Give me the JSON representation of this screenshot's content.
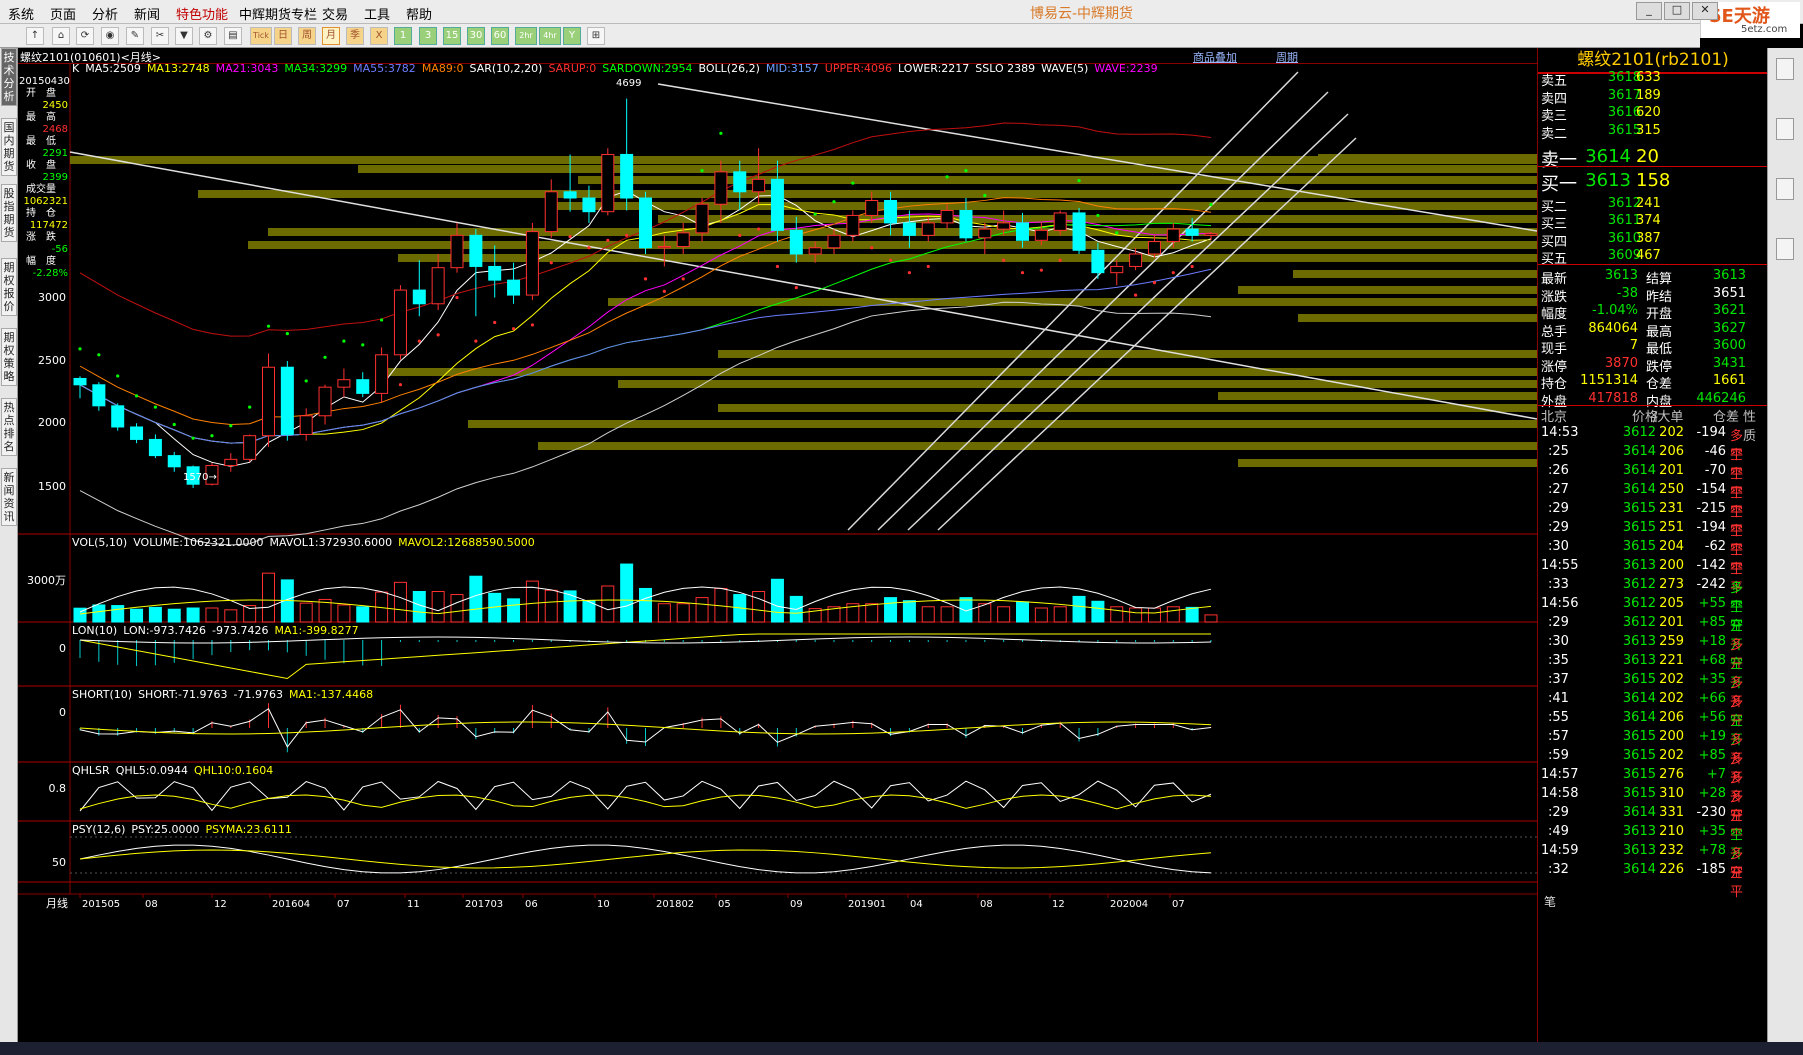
{
  "menu": [
    "系统",
    "页面",
    "分析",
    "新闻",
    "特色功能",
    "中辉期货专栏",
    "交易",
    "工具",
    "帮助"
  ],
  "app_title": "博易云-中辉期货",
  "logo": {
    "text": "5E天游",
    "sub": "5etz.com"
  },
  "window_buttons": [
    "_",
    "□",
    "✕"
  ],
  "toolbar": {
    "buttons": [
      "↑",
      "⌂",
      "⟳",
      "◉",
      "✎",
      "✂",
      "▼",
      "⚙",
      "▤",
      "Tick",
      "日",
      "周",
      "月",
      "季",
      "X",
      "1",
      "3",
      "15",
      "30",
      "60",
      "2hr",
      "4hr",
      "Y",
      "⊞"
    ],
    "selected": "月"
  },
  "left_tabs": [
    "技术分析",
    "国内期货",
    "股指期货",
    "期权报价",
    "期权策略",
    "热点排名",
    "新闻资讯"
  ],
  "chart_header": {
    "title": "螺纹2101(010601)<月线>",
    "links": [
      "商品叠加",
      "周期"
    ]
  },
  "main_indicator_line": [
    {
      "t": "K",
      "c": "#ffffff"
    },
    {
      "t": "MA5:2509",
      "c": "#ffffff"
    },
    {
      "t": "MA13:2748",
      "c": "#ffff00"
    },
    {
      "t": "MA21:3043",
      "c": "#ff00ff"
    },
    {
      "t": "MA34:3299",
      "c": "#00ff00"
    },
    {
      "t": "MA55:3782",
      "c": "#6c7cff"
    },
    {
      "t": "MA89:0",
      "c": "#ff8000"
    },
    {
      "t": "SAR(10,2,20)",
      "c": "#ffffff"
    },
    {
      "t": "SARUP:0",
      "c": "#ff3030"
    },
    {
      "t": "SARDOWN:2954",
      "c": "#00ff00"
    },
    {
      "t": "BOLL(26,2)",
      "c": "#ffffff"
    },
    {
      "t": "MID:3157",
      "c": "#6ca0ff"
    },
    {
      "t": "UPPER:4096",
      "c": "#ff3030"
    },
    {
      "t": "LOWER:2217",
      "c": "#ffffff"
    },
    {
      "t": "SSLO 2389",
      "c": "#ffffff"
    },
    {
      "t": "WAVE(5)",
      "c": "#ffffff"
    },
    {
      "t": "WAVE:2239",
      "c": "#ff00ff"
    }
  ],
  "info_box": {
    "date": "20150430",
    "items": [
      [
        "开　盘",
        "2450"
      ],
      [
        "最　高",
        "2468"
      ],
      [
        "最　低",
        "2291"
      ],
      [
        "收　盘",
        "2399"
      ],
      [
        "成交量",
        "1062321"
      ],
      [
        "持　仓",
        "117472"
      ],
      [
        "涨　跌",
        "-56"
      ],
      [
        "幅　度",
        "-2.28%"
      ]
    ]
  },
  "price_labels": {
    "high": "4699",
    "low": "1570",
    "arrow_low": "1570→"
  },
  "y_axis_main": [
    "3000",
    "2500",
    "2000",
    "1500"
  ],
  "x_axis": {
    "period": "月线",
    "ticks": [
      "201505",
      "08",
      "12",
      "201604",
      "07",
      "11",
      "201703",
      "06",
      "10",
      "201802",
      "05",
      "09",
      "201901",
      "04",
      "08",
      "12",
      "202004",
      "07"
    ]
  },
  "panes": [
    {
      "id": "vol",
      "header": [
        {
          "t": "VOL(5,10)",
          "c": "#ffffff"
        },
        {
          "t": "VOLUME:1062321.0000",
          "c": "#ffffff"
        },
        {
          "t": "MAVOL1:372930.6000",
          "c": "#ffffff"
        },
        {
          "t": "MAVOL2:12688590.5000",
          "c": "#ffff00"
        }
      ],
      "ylabel": "3000万"
    },
    {
      "id": "lon",
      "header": [
        {
          "t": "LON(10)",
          "c": "#ffffff"
        },
        {
          "t": "LON:-973.7426",
          "c": "#ffffff"
        },
        {
          "t": "-973.7426",
          "c": "#ffffff"
        },
        {
          "t": "MA1:-399.8277",
          "c": "#ffff00"
        }
      ],
      "ylabel": "0"
    },
    {
      "id": "short",
      "header": [
        {
          "t": "SHORT(10)",
          "c": "#ffffff"
        },
        {
          "t": "SHORT:-71.9763",
          "c": "#ffffff"
        },
        {
          "t": "-71.9763",
          "c": "#ffffff"
        },
        {
          "t": "MA1:-137.4468",
          "c": "#ffff00"
        }
      ],
      "ylabel": "0"
    },
    {
      "id": "qhlsr",
      "header": [
        {
          "t": "QHLSR",
          "c": "#ffffff"
        },
        {
          "t": "QHL5:0.0944",
          "c": "#ffffff"
        },
        {
          "t": "QHL10:0.1604",
          "c": "#ffff00"
        }
      ],
      "ylabel": "0.8"
    },
    {
      "id": "psy",
      "header": [
        {
          "t": "PSY(12,6)",
          "c": "#ffffff"
        },
        {
          "t": "PSY:25.0000",
          "c": "#ffffff"
        },
        {
          "t": "PSYMA:23.6111",
          "c": "#ffff00"
        }
      ],
      "ylabel": "50"
    }
  ],
  "quote": {
    "title": "螺纹2101(rb2101)",
    "asks": [
      [
        "卖五",
        "3618",
        "633"
      ],
      [
        "卖四",
        "3617",
        "189"
      ],
      [
        "卖三",
        "3616",
        "620"
      ],
      [
        "卖二",
        "3615",
        "315"
      ],
      [
        "卖一",
        "3614",
        "20"
      ]
    ],
    "bids": [
      [
        "买一",
        "3613",
        "158"
      ],
      [
        "买二",
        "3612",
        "241"
      ],
      [
        "买三",
        "3611",
        "374"
      ],
      [
        "买四",
        "3610",
        "387"
      ],
      [
        "买五",
        "3609",
        "467"
      ]
    ],
    "stats": [
      [
        "最新",
        "3613",
        "green",
        "结算",
        "3613",
        "green"
      ],
      [
        "涨跌",
        "-38",
        "green",
        "昨结",
        "3651",
        "wht"
      ],
      [
        "幅度",
        "-1.04%",
        "green",
        "开盘",
        "3621",
        "green"
      ],
      [
        "总手",
        "864064",
        "yel",
        "最高",
        "3627",
        "green"
      ],
      [
        "现手",
        "7",
        "yel",
        "最低",
        "3600",
        "green"
      ],
      [
        "涨停",
        "3870",
        "red",
        "跌停",
        "3431",
        "green"
      ],
      [
        "持仓",
        "1151314",
        "yel",
        "仓差",
        "1661",
        "yel"
      ],
      [
        "外盘",
        "417818",
        "red",
        "内盘",
        "446246",
        "green"
      ]
    ],
    "tick_header": [
      "北京",
      "价格",
      "∕大单",
      "仓差",
      "性质"
    ],
    "ticks": [
      [
        "14:53",
        "3612",
        "202",
        "-194",
        "多平",
        "red"
      ],
      [
        ":25",
        "3614",
        "206",
        "-46",
        "空平",
        "red"
      ],
      [
        ":26",
        "3614",
        "201",
        "-70",
        "空平",
        "red"
      ],
      [
        ":27",
        "3614",
        "250",
        "-154",
        "空平",
        "red"
      ],
      [
        ":29",
        "3615",
        "231",
        "-215",
        "空平",
        "red"
      ],
      [
        ":29",
        "3615",
        "251",
        "-194",
        "空平",
        "red"
      ],
      [
        ":30",
        "3615",
        "204",
        "-62",
        "空平",
        "red"
      ],
      [
        "14:55",
        "3613",
        "200",
        "-142",
        "空平",
        "red"
      ],
      [
        ":33",
        "3612",
        "273",
        "-242",
        "多平",
        "green"
      ],
      [
        "14:56",
        "3612",
        "205",
        "+55",
        "空开",
        "green"
      ],
      [
        ":29",
        "3612",
        "201",
        "+85",
        "空开",
        "green"
      ],
      [
        ":30",
        "3613",
        "259",
        "+18",
        "多开",
        "red"
      ],
      [
        ":35",
        "3613",
        "221",
        "+68",
        "空开",
        "green"
      ],
      [
        ":37",
        "3615",
        "202",
        "+35",
        "多开",
        "red"
      ],
      [
        ":41",
        "3614",
        "202",
        "+66",
        "多开",
        "red"
      ],
      [
        ":55",
        "3614",
        "206",
        "+56",
        "空开",
        "green"
      ],
      [
        ":57",
        "3615",
        "200",
        "+19",
        "多开",
        "red"
      ],
      [
        ":59",
        "3615",
        "202",
        "+85",
        "多开",
        "red"
      ],
      [
        "14:57",
        "3615",
        "276",
        "+7",
        "多开",
        "red"
      ],
      [
        "14:58",
        "3615",
        "310",
        "+28",
        "多开",
        "red"
      ],
      [
        ":29",
        "3614",
        "331",
        "-230",
        "空平",
        "red"
      ],
      [
        ":49",
        "3613",
        "210",
        "+35",
        "空开",
        "green"
      ],
      [
        "14:59",
        "3613",
        "232",
        "+78",
        "多开",
        "red"
      ],
      [
        ":32",
        "3614",
        "226",
        "-185",
        "空平",
        "red"
      ]
    ],
    "footer": "笔"
  },
  "colors": {
    "up": "#ff3030",
    "down": "#00ffff",
    "bg": "#000000",
    "frame": "#8b0000"
  },
  "chart_data": {
    "type": "candlestick",
    "period": "monthly",
    "start": "2015-05",
    "ohlc": [
      [
        2450,
        2468,
        2291,
        2399
      ],
      [
        2399,
        2420,
        2190,
        2230
      ],
      [
        2230,
        2250,
        2030,
        2060
      ],
      [
        2060,
        2090,
        1930,
        1960
      ],
      [
        1960,
        2000,
        1810,
        1830
      ],
      [
        1830,
        1860,
        1700,
        1740
      ],
      [
        1740,
        1750,
        1570,
        1600
      ],
      [
        1600,
        1770,
        1590,
        1750
      ],
      [
        1750,
        1850,
        1700,
        1800
      ],
      [
        1800,
        2000,
        1780,
        1990
      ],
      [
        1990,
        2650,
        1900,
        2540
      ],
      [
        2540,
        2590,
        1950,
        2000
      ],
      [
        2000,
        2210,
        1950,
        2150
      ],
      [
        2150,
        2400,
        2080,
        2380
      ],
      [
        2380,
        2530,
        2300,
        2440
      ],
      [
        2440,
        2500,
        2300,
        2330
      ],
      [
        2330,
        2700,
        2260,
        2640
      ],
      [
        2640,
        3200,
        2600,
        3160
      ],
      [
        3160,
        3400,
        2950,
        3050
      ],
      [
        3050,
        3450,
        3000,
        3340
      ],
      [
        3340,
        3700,
        3300,
        3600
      ],
      [
        3600,
        3650,
        2950,
        3350
      ],
      [
        3350,
        3520,
        3100,
        3240
      ],
      [
        3240,
        3380,
        3050,
        3120
      ],
      [
        3120,
        3700,
        3080,
        3630
      ],
      [
        3630,
        4050,
        3580,
        3950
      ],
      [
        3950,
        4250,
        3790,
        3900
      ],
      [
        3900,
        4000,
        3700,
        3790
      ],
      [
        3790,
        4300,
        3760,
        4250
      ],
      [
        4250,
        4699,
        3800,
        3900
      ],
      [
        3900,
        3950,
        3450,
        3500
      ],
      [
        3500,
        3600,
        3350,
        3510
      ],
      [
        3510,
        3700,
        3450,
        3620
      ],
      [
        3620,
        3900,
        3550,
        3850
      ],
      [
        3850,
        4200,
        3700,
        4110
      ],
      [
        4110,
        4200,
        3800,
        3950
      ],
      [
        3950,
        4300,
        3850,
        4050
      ],
      [
        4050,
        4200,
        3550,
        3640
      ],
      [
        3640,
        3750,
        3380,
        3450
      ],
      [
        3450,
        3550,
        3380,
        3500
      ],
      [
        3500,
        3650,
        3450,
        3600
      ],
      [
        3600,
        3800,
        3550,
        3760
      ],
      [
        3760,
        3950,
        3700,
        3880
      ],
      [
        3880,
        3950,
        3600,
        3700
      ],
      [
        3700,
        3800,
        3500,
        3600
      ],
      [
        3600,
        3750,
        3550,
        3700
      ],
      [
        3700,
        3850,
        3650,
        3800
      ],
      [
        3800,
        3900,
        3550,
        3580
      ],
      [
        3580,
        3700,
        3450,
        3650
      ],
      [
        3650,
        3800,
        3600,
        3700
      ],
      [
        3700,
        3780,
        3500,
        3560
      ],
      [
        3560,
        3700,
        3520,
        3640
      ],
      [
        3640,
        3800,
        3600,
        3780
      ],
      [
        3780,
        3820,
        3450,
        3480
      ],
      [
        3480,
        3540,
        3250,
        3300
      ],
      [
        3300,
        3400,
        3200,
        3350
      ],
      [
        3350,
        3500,
        3320,
        3450
      ],
      [
        3450,
        3600,
        3420,
        3550
      ],
      [
        3550,
        3700,
        3500,
        3650
      ],
      [
        3650,
        3740,
        3550,
        3600
      ],
      [
        3600,
        3627,
        3560,
        3613
      ]
    ],
    "y_range": [
      1200,
      4800
    ]
  }
}
